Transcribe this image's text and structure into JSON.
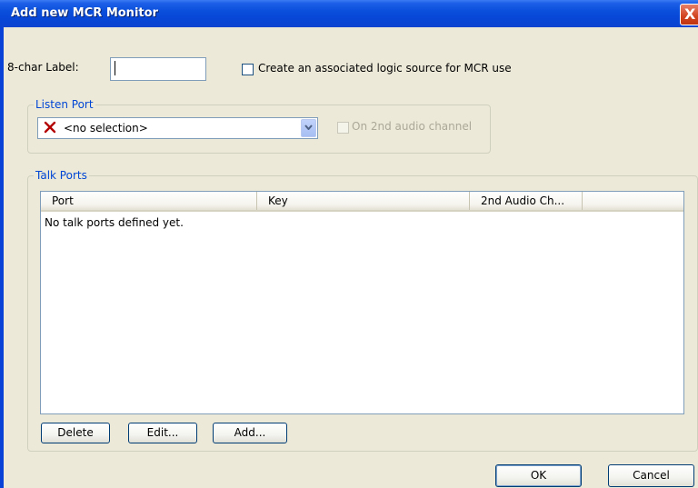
{
  "window": {
    "title": "Add new MCR Monitor",
    "close_glyph": "X"
  },
  "label_field": {
    "label": "8-char Label:",
    "value": ""
  },
  "logic_source": {
    "label": "Create an associated logic source for MCR use",
    "checked": false
  },
  "listen_port": {
    "group_title": "Listen Port",
    "selected_value": "<no selection>",
    "status_icon": "x-mark-icon",
    "second_channel_label": "On 2nd audio channel"
  },
  "talk_ports": {
    "group_title": "Talk Ports",
    "columns": [
      "Port",
      "Key",
      "2nd Audio Ch..."
    ],
    "empty_message": "No talk ports defined yet.",
    "buttons": {
      "delete": "Delete",
      "edit": "Edit...",
      "add": "Add..."
    }
  },
  "footer": {
    "ok": "OK",
    "cancel": "Cancel"
  },
  "colors": {
    "title_bar": "#0a4fdc",
    "group_title": "#0046d5",
    "x_mark": "#b40000",
    "dialog_bg": "#ece9d8"
  }
}
